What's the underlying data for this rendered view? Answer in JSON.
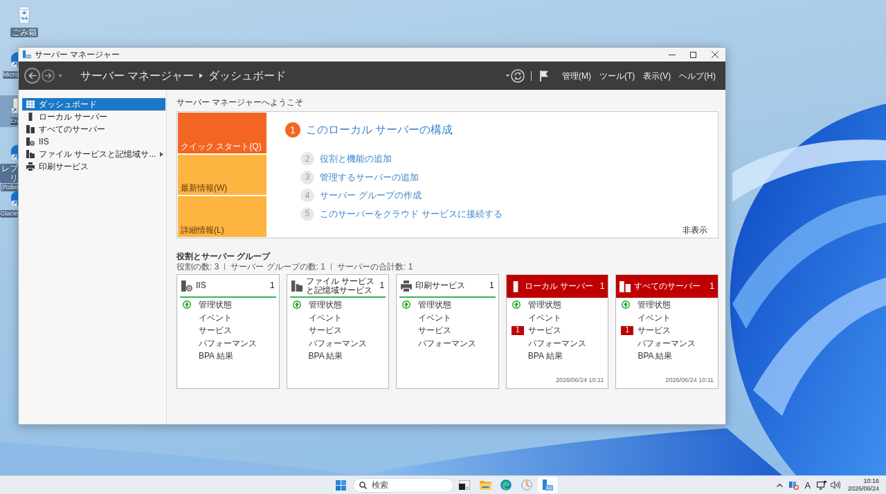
{
  "desktop": {
    "icons": [
      {
        "kind": "recycle-bin",
        "lines": [
          "ごみ箱"
        ],
        "selected": false
      },
      {
        "kind": "shortcut",
        "lines": [
          "Micro"
        ],
        "selected": false
      },
      {
        "kind": "file-shortcut",
        "lines": [
          "En"
        ],
        "selected": true
      },
      {
        "kind": "shortcut",
        "lines": [
          "レプリ",
          "(Robo"
        ],
        "selected": false
      },
      {
        "kind": "shortcut",
        "lines": [
          "Glacie"
        ],
        "selected": false
      }
    ]
  },
  "window": {
    "title": "サーバー マネージャー"
  },
  "header": {
    "breadcrumb": [
      "サーバー マネージャー",
      "ダッシュボード"
    ],
    "menu": [
      "管理(M)",
      "ツール(T)",
      "表示(V)",
      "ヘルプ(H)"
    ]
  },
  "sidebar": {
    "items": [
      {
        "label": "ダッシュボード",
        "kind": "dashboard",
        "selected": true,
        "submenu": false
      },
      {
        "label": "ローカル サーバー",
        "kind": "server",
        "selected": false,
        "submenu": false
      },
      {
        "label": "すべてのサーバー",
        "kind": "servers",
        "selected": false,
        "submenu": false
      },
      {
        "label": "IIS",
        "kind": "iis",
        "selected": false,
        "submenu": false
      },
      {
        "label": "ファイル サービスと記憶域サ...",
        "kind": "file-storage",
        "selected": false,
        "submenu": true
      },
      {
        "label": "印刷サービス",
        "kind": "printer",
        "selected": false,
        "submenu": false
      }
    ]
  },
  "welcome": {
    "title": "サーバー マネージャーへようこそ",
    "tabs": [
      {
        "label": "クイック スタート(Q)",
        "selected": true
      },
      {
        "label": "最新情報(W)",
        "selected": false
      },
      {
        "label": "詳細情報(L)",
        "selected": false
      }
    ],
    "steps": [
      {
        "number": "1",
        "label": "このローカル サーバーの構成",
        "current": true
      },
      {
        "number": "2",
        "label": "役割と機能の追加",
        "current": false
      },
      {
        "number": "3",
        "label": "管理するサーバーの追加",
        "current": false
      },
      {
        "number": "4",
        "label": "サーバー グループの作成",
        "current": false
      },
      {
        "number": "5",
        "label": "このサーバーをクラウド サービスに接続する",
        "current": false
      }
    ],
    "hide": "非表示"
  },
  "roles": {
    "title": "役割とサーバー グループ",
    "summary": [
      "役割の数: 3",
      "サーバー グループの数: 1",
      "サーバーの合計数: 1"
    ],
    "tiles": [
      {
        "title": "IIS",
        "kind": "iis",
        "count": "1",
        "alert": false,
        "rows": [
          {
            "label": "管理状態",
            "ok": true
          },
          {
            "label": "イベント",
            "ok": false
          },
          {
            "label": "サービス",
            "ok": false
          },
          {
            "label": "パフォーマンス",
            "ok": false
          },
          {
            "label": "BPA 結果",
            "ok": false
          }
        ]
      },
      {
        "title": "ファイル サービスと記憶域サービス",
        "kind": "file-storage",
        "count": "1",
        "alert": false,
        "rows": [
          {
            "label": "管理状態",
            "ok": true
          },
          {
            "label": "イベント",
            "ok": false
          },
          {
            "label": "サービス",
            "ok": false
          },
          {
            "label": "パフォーマンス",
            "ok": false
          },
          {
            "label": "BPA 結果",
            "ok": false
          }
        ]
      },
      {
        "title": "印刷サービス",
        "kind": "printer",
        "count": "1",
        "alert": false,
        "rows": [
          {
            "label": "管理状態",
            "ok": true
          },
          {
            "label": "イベント",
            "ok": false
          },
          {
            "label": "サービス",
            "ok": false
          },
          {
            "label": "パフォーマンス",
            "ok": false
          }
        ]
      },
      {
        "title": "ローカル サーバー",
        "kind": "server",
        "count": "1",
        "alert": true,
        "rows": [
          {
            "label": "管理状態",
            "ok": true
          },
          {
            "label": "イベント",
            "ok": false
          },
          {
            "label": "サービス",
            "ok": false,
            "alert_count": "1"
          },
          {
            "label": "パフォーマンス",
            "ok": false
          },
          {
            "label": "BPA 結果",
            "ok": false
          }
        ],
        "updated": "2026/06/24 10:11"
      },
      {
        "title": "すべてのサーバー",
        "kind": "servers",
        "count": "1",
        "alert": true,
        "rows": [
          {
            "label": "管理状態",
            "ok": true
          },
          {
            "label": "イベント",
            "ok": false
          },
          {
            "label": "サービス",
            "ok": false,
            "alert_count": "1"
          },
          {
            "label": "パフォーマンス",
            "ok": false
          },
          {
            "label": "BPA 結果",
            "ok": false
          }
        ],
        "updated": "2026/06/24 10:11"
      }
    ]
  },
  "taskbar": {
    "search": {
      "placeholder": "検索"
    },
    "apps": [
      {
        "kind": "terminal",
        "selected": false
      },
      {
        "kind": "folder",
        "selected": false
      },
      {
        "kind": "browser",
        "selected": false
      },
      {
        "kind": "clock",
        "selected": false
      },
      {
        "kind": "server-manager",
        "selected": true
      }
    ],
    "tray": {
      "ime": "A",
      "time": "10:16",
      "date": "2026/06/24"
    }
  }
}
